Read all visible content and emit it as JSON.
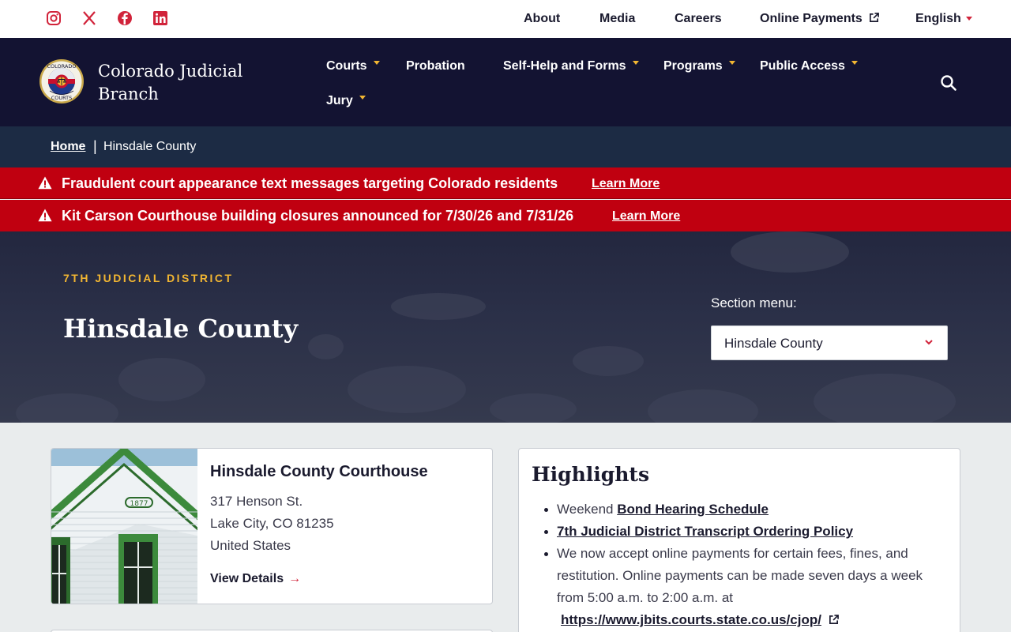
{
  "utility": {
    "links": {
      "about": "About",
      "media": "Media",
      "careers": "Careers",
      "payments": "Online Payments",
      "language": "English"
    }
  },
  "header": {
    "brand": "Colorado Judicial Branch",
    "nav": {
      "courts": "Courts",
      "probation": "Probation",
      "self_help": "Self-Help and Forms",
      "programs": "Programs",
      "public_access": "Public Access",
      "jury": "Jury"
    }
  },
  "breadcrumb": {
    "home": "Home",
    "separator": "|",
    "current": "Hinsdale County"
  },
  "alerts": [
    {
      "text": "Fraudulent court appearance text messages targeting Colorado residents",
      "link": "Learn More"
    },
    {
      "text": "Kit Carson Courthouse building closures announced for 7/30/26 and 7/31/26",
      "link": "Learn More"
    }
  ],
  "hero": {
    "eyebrow": "7TH JUDICIAL DISTRICT",
    "title": "Hinsdale County",
    "section_menu_label": "Section menu:",
    "section_menu_value": "Hinsdale County"
  },
  "courthouse": {
    "title": "Hinsdale County Courthouse",
    "address_line1": "317 Henson St.",
    "address_line2": "Lake City, CO 81235",
    "address_line3": "United States",
    "view_details": "View Details",
    "building_year": "1877"
  },
  "highlights": {
    "title": "Highlights",
    "item1_prefix": "Weekend ",
    "item1_link": "Bond Hearing Schedule",
    "item2_link": "7th Judicial District Transcript Ordering Policy",
    "item3_text": "We now accept online payments for certain fees, fines, and restitution. Online payments can be made seven days a week from 5:00 a.m. to 2:00 a.m. at",
    "item3_link": "https://www.jbits.courts.state.co.us/cjop/"
  },
  "colors": {
    "navy": "#131332",
    "alert_red": "#c00010",
    "accent_gold": "#f2b632",
    "accent_red": "#d1233a"
  },
  "icons": [
    "instagram-icon",
    "x-icon",
    "facebook-icon",
    "linkedin-icon",
    "external-link-icon",
    "caret-down-icon",
    "search-icon",
    "warning-icon",
    "chevron-down-icon",
    "arrow-right-icon"
  ]
}
